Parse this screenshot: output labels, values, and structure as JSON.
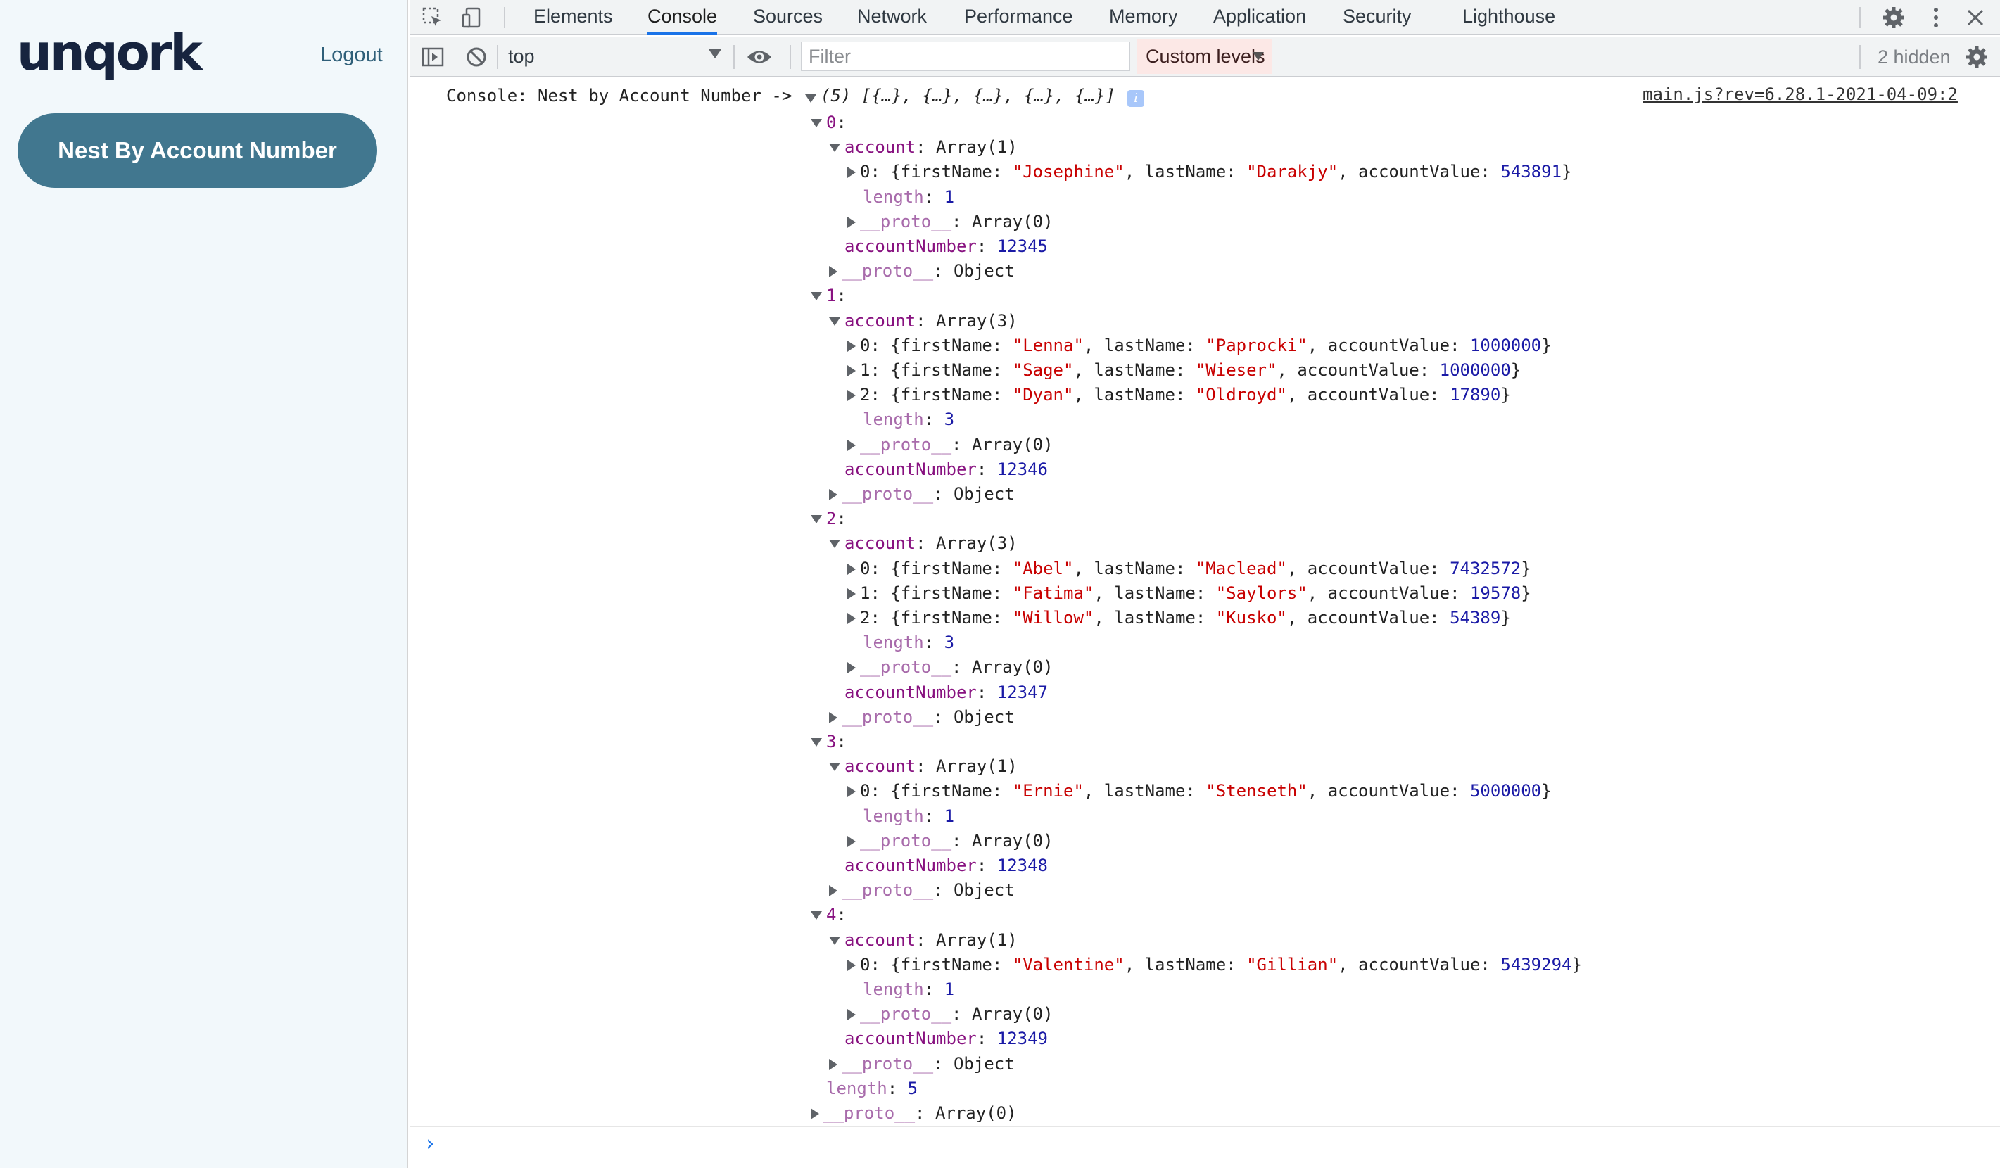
{
  "app": {
    "logo": "unqork",
    "logout_label": "Logout",
    "nest_button_label": "Nest By Account Number"
  },
  "devtools": {
    "tabs": [
      "Elements",
      "Console",
      "Sources",
      "Network",
      "Performance",
      "Memory",
      "Application",
      "Security",
      "Lighthouse"
    ],
    "active_tab": "Console",
    "toolbar": {
      "context": "top",
      "filter_placeholder": "Filter",
      "levels": "Custom levels",
      "hidden": "2 hidden"
    },
    "console": {
      "prefix": "Console: Nest by Account Number -> ",
      "summary": "(5) [{…}, {…}, {…}, {…}, {…}]",
      "info_badge": "i",
      "source": "main.js?rev=6.28.1-2021-04-09:2",
      "prompt": "›",
      "groups": [
        {
          "index": "0",
          "account_label": "Array(1)",
          "entries": [
            {
              "i": "0",
              "firstName": "\"Josephine\"",
              "lastName": "\"Darakjy\"",
              "accountValue": "543891"
            }
          ],
          "length": "1",
          "accountNumber": "12345"
        },
        {
          "index": "1",
          "account_label": "Array(3)",
          "entries": [
            {
              "i": "0",
              "firstName": "\"Lenna\"",
              "lastName": "\"Paprocki\"",
              "accountValue": "1000000"
            },
            {
              "i": "1",
              "firstName": "\"Sage\"",
              "lastName": "\"Wieser\"",
              "accountValue": "1000000"
            },
            {
              "i": "2",
              "firstName": "\"Dyan\"",
              "lastName": "\"Oldroyd\"",
              "accountValue": "17890"
            }
          ],
          "length": "3",
          "accountNumber": "12346"
        },
        {
          "index": "2",
          "account_label": "Array(3)",
          "entries": [
            {
              "i": "0",
              "firstName": "\"Abel\"",
              "lastName": "\"Maclead\"",
              "accountValue": "7432572"
            },
            {
              "i": "1",
              "firstName": "\"Fatima\"",
              "lastName": "\"Saylors\"",
              "accountValue": "19578"
            },
            {
              "i": "2",
              "firstName": "\"Willow\"",
              "lastName": "\"Kusko\"",
              "accountValue": "54389"
            }
          ],
          "length": "3",
          "accountNumber": "12347"
        },
        {
          "index": "3",
          "account_label": "Array(1)",
          "entries": [
            {
              "i": "0",
              "firstName": "\"Ernie\"",
              "lastName": "\"Stenseth\"",
              "accountValue": "5000000"
            }
          ],
          "length": "1",
          "accountNumber": "12348"
        },
        {
          "index": "4",
          "account_label": "Array(1)",
          "entries": [
            {
              "i": "0",
              "firstName": "\"Valentine\"",
              "lastName": "\"Gillian\"",
              "accountValue": "5439294"
            }
          ],
          "length": "1",
          "accountNumber": "12349"
        }
      ],
      "total_length": "5",
      "labels": {
        "account": "account",
        "accountNumber": "accountNumber",
        "length": "length",
        "proto": "__proto__",
        "array0": "Array(0)",
        "object": "Object",
        "firstName": "firstName",
        "lastName": "lastName",
        "accountValue": "accountValue"
      }
    }
  },
  "colors": {
    "button_bg": "#41778f",
    "logo": "#17243f",
    "active_tab": "#1a73e8",
    "key": "#881280",
    "string": "#c80000",
    "number": "#1a1aa6"
  }
}
